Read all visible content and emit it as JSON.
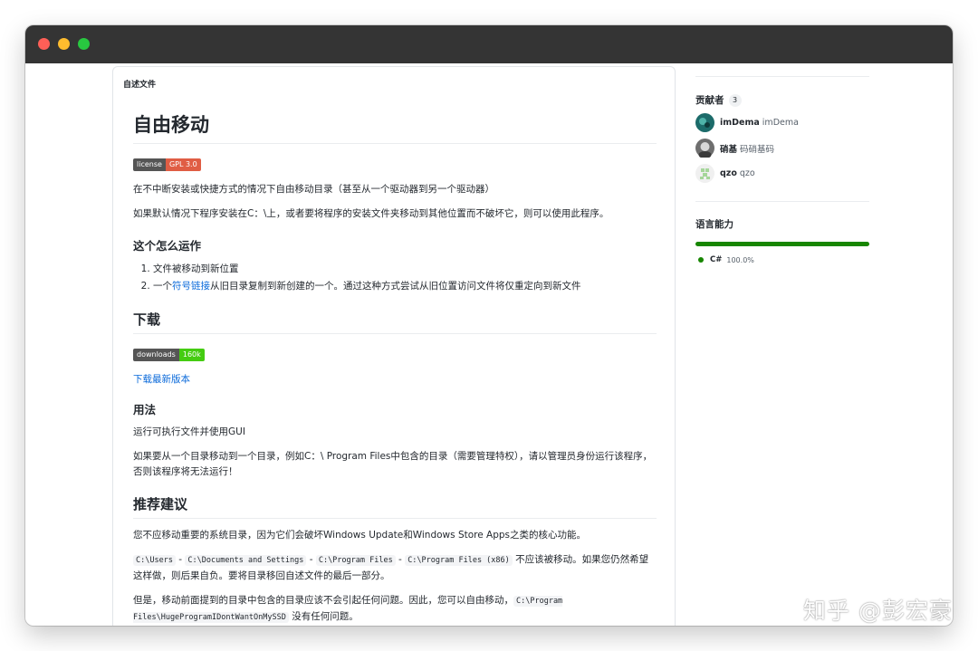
{
  "window": {
    "colors": {
      "titlebar": "#343434",
      "close": "#ff5f57",
      "minimize": "#febc2e",
      "maximize": "#28c840"
    }
  },
  "readme": {
    "header": "自述文件",
    "title": "自由移动",
    "license_badge": {
      "left": "license",
      "right": "GPL 3.0",
      "color": "#e05d44"
    },
    "intro1": "在不中断安装或快捷方式的情况下自由移动目录（甚至从一个驱动器到另一个驱动器）",
    "intro2": "如果默认情况下程序安装在C：\\上，或者要将程序的安装文件夹移动到其他位置而不破坏它，则可以使用此程序。",
    "how_heading": "这个怎么运作",
    "steps": {
      "s1": "文件被移动到新位置",
      "s2_pre": "一个",
      "s2_link": "符号链接",
      "s2_post": "从旧目录复制到新创建的一个。通过这种方式尝试从旧位置访问文件将仅重定向到新文件"
    },
    "download_heading": "下载",
    "downloads_badge": {
      "left": "downloads",
      "right": "160k",
      "color": "#4c1"
    },
    "download_link": "下载最新版本",
    "usage_heading": "用法",
    "usage1": "运行可执行文件并使用GUI",
    "usage2": "如果要从一个目录移动到一个目录，例如C：\\ Program Files中包含的目录（需要管理特权），请以管理员身份运行该程序，否则该程序将无法运行！",
    "rec_heading": "推荐建议",
    "rec1": "您不应移动重要的系统目录，因为它们会破坏Windows Update和Windows Store Apps之类的核心功能。",
    "rec2": {
      "code1": "C:\\Users",
      "sep": " - ",
      "code2": "C:\\Documents and Settings",
      "code3": "C:\\Program Files",
      "code4": "C:\\Program Files (x86)",
      "text": " 不应该被移动。如果您仍然希望这样做，则后果自负。要将目录移回自述文件的最后一部分。"
    },
    "rec3": {
      "text": "但是，移动前面提到的目录中包含的目录应该不会引起任何问题。因此，您可以自由移动，",
      "code": "C:\\Program Files\\HugeProgramIDontWantOnMySSD",
      "tail": " 没有任何问题。"
    }
  },
  "sidebar": {
    "contributors_title": "贡献者",
    "contributors_count": "3",
    "contributors": [
      {
        "login": "imDema",
        "name": "imDema",
        "avatar_color": "#1c6b6a",
        "icon": "avatar-icon"
      },
      {
        "login": "硝基",
        "name": "码硝基码",
        "avatar_color": "#8a8a8a",
        "icon": "avatar-icon"
      },
      {
        "login": "qzo",
        "name": "qzo",
        "avatar_color": "#a6d69a",
        "icon": "identicon-icon"
      }
    ],
    "languages_title": "语言能力",
    "language": {
      "name": "C#",
      "percent": "100.0%",
      "color": "#178600"
    }
  },
  "watermark": "知乎 @彭宏豪"
}
